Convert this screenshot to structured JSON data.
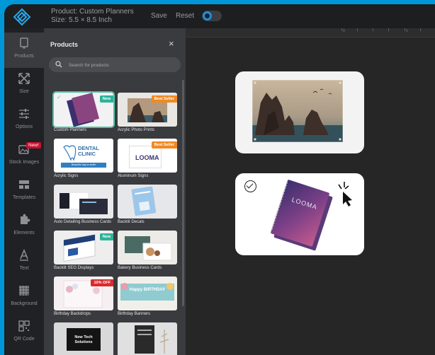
{
  "header": {
    "product_label": "Product: Custom Planners",
    "size_label": "Size: 5.5 × 8.5 Inch",
    "save_label": "Save",
    "reset_label": "Reset",
    "accent_color": "#1d8fe0"
  },
  "sidebar": {
    "items": [
      {
        "label": "Products",
        "icon": "product-icon"
      },
      {
        "label": "Size",
        "icon": "resize-icon"
      },
      {
        "label": "Options",
        "icon": "sliders-icon"
      },
      {
        "label": "Stock Images",
        "icon": "images-icon",
        "badge": "New!"
      },
      {
        "label": "Templates",
        "icon": "templates-icon"
      },
      {
        "label": "Elements",
        "icon": "puzzle-icon"
      },
      {
        "label": "Text",
        "icon": "text-icon"
      },
      {
        "label": "Background",
        "icon": "pattern-icon"
      },
      {
        "label": "QR Code",
        "icon": "qr-code-icon"
      }
    ]
  },
  "ruler": {
    "marks": [
      "0",
      "1"
    ]
  },
  "panel": {
    "title": "Products",
    "close_glyph": "×",
    "search_placeholder": "Search for products",
    "products": [
      {
        "name": "Custom Planners",
        "badge": "New",
        "selected": true,
        "thumb_color": "#2e8f7c"
      },
      {
        "name": "Acrylic Photo Prints",
        "badge": "Best Seller",
        "thumb_color": "#e9e7e4"
      },
      {
        "name": "Acrylic Signs",
        "thumb_color": "#ffffff",
        "thumb_text": "DENTAL CLINIC",
        "thumb_subtext": "Beautiful day to smile"
      },
      {
        "name": "Aluminum Signs",
        "badge": "Best Seller",
        "thumb_color": "#ffffff",
        "thumb_text": "LOOMA"
      },
      {
        "name": "Auto Detailing Business Cards",
        "thumb_color": "#e9e9ec"
      },
      {
        "name": "Backlit Decals",
        "thumb_color": "#e6e7ea"
      },
      {
        "name": "Backlit SEG Displays",
        "badge": "New",
        "thumb_color": "#eeeeee"
      },
      {
        "name": "Bakery Business Cards",
        "thumb_color": "#ecebe8"
      },
      {
        "name": "Birthday Backdrops",
        "badge": "10% OFF",
        "thumb_color": "#f6eff2"
      },
      {
        "name": "Birthday Banners",
        "thumb_color": "#f1efe9",
        "thumb_text": "Happy BIRTHDAY"
      },
      {
        "name": "",
        "thumb_color": "#d9d9d9",
        "thumb_text": "New Tech Solutions"
      },
      {
        "name": "",
        "thumb_color": "#e0e0e0"
      }
    ]
  }
}
